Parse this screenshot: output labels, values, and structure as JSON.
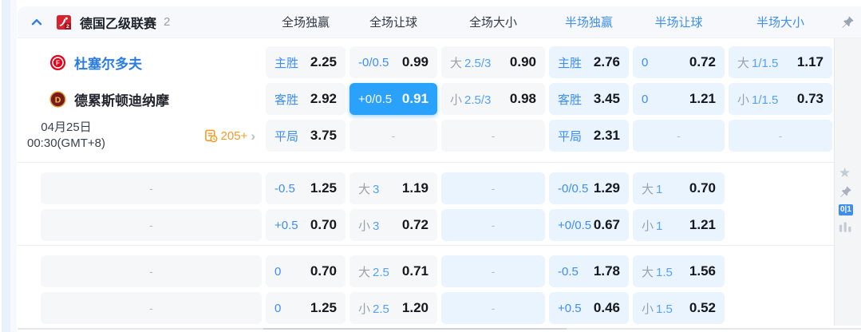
{
  "league_header": {
    "title": "德国乙级联赛",
    "match_count": "2",
    "full_columns": [
      "全场独赢",
      "全场让球",
      "全场大小"
    ],
    "half_columns": [
      "半场独赢",
      "半场让球",
      "半场大小"
    ]
  },
  "match_info": {
    "home_team": "杜塞尔多夫",
    "away_team": "德累斯顿迪纳摩",
    "date": "04月25日",
    "time": "00:30(GMT+8)",
    "markets_count": "205+"
  },
  "icons": {
    "more_chevron": "›",
    "star": "★",
    "compare_badge": "0|1"
  },
  "colors": {
    "accent_blue": "#3d8df5",
    "selected_cell": "#2aa1fb",
    "orange": "#f59b25"
  },
  "odds": {
    "block1": {
      "row1": {
        "ft_win": {
          "label": "主胜",
          "value": "2.25"
        },
        "ft_hcp": {
          "label": "-0/0.5",
          "value": "0.99"
        },
        "ft_ou": {
          "side": "大",
          "line": "2.5/3",
          "value": "0.90"
        },
        "ht_win": {
          "label": "主胜",
          "value": "2.76"
        },
        "ht_hcp": {
          "label": "0",
          "value": "0.72"
        },
        "ht_ou": {
          "side": "大",
          "line": "1/1.5",
          "value": "1.17"
        }
      },
      "row2": {
        "ft_win": {
          "label": "客胜",
          "value": "2.92"
        },
        "ft_hcp": {
          "label": "+0/0.5",
          "value": "0.91",
          "selected": true
        },
        "ft_ou": {
          "side": "小",
          "line": "2.5/3",
          "value": "0.98"
        },
        "ht_win": {
          "label": "客胜",
          "value": "3.45"
        },
        "ht_hcp": {
          "label": "0",
          "value": "1.21"
        },
        "ht_ou": {
          "side": "小",
          "line": "1/1.5",
          "value": "0.73"
        }
      },
      "row3": {
        "ft_win": {
          "label": "平局",
          "value": "3.75"
        },
        "ft_hcp": {
          "dash": "-"
        },
        "ft_ou": {
          "dash": "-"
        },
        "ht_win": {
          "label": "平局",
          "value": "2.31"
        },
        "ht_hcp": {
          "dash": "-"
        },
        "ht_ou": {
          "dash": "-"
        }
      }
    },
    "block2": {
      "row1": {
        "ft_win": {
          "dash": "-"
        },
        "ft_hcp": {
          "label": "-0.5",
          "value": "1.25"
        },
        "ft_ou": {
          "side": "大",
          "line": "3",
          "value": "1.19"
        },
        "ht_win": {
          "dash": "-"
        },
        "ht_hcp": {
          "label": "-0/0.5",
          "value": "1.29"
        },
        "ht_ou": {
          "side": "大",
          "line": "1",
          "value": "0.70"
        }
      },
      "row2": {
        "ft_win": {
          "dash": "-"
        },
        "ft_hcp": {
          "label": "+0.5",
          "value": "0.70"
        },
        "ft_ou": {
          "side": "小",
          "line": "3",
          "value": "0.72"
        },
        "ht_win": {
          "dash": "-"
        },
        "ht_hcp": {
          "label": "+0/0.5",
          "value": "0.67"
        },
        "ht_ou": {
          "side": "小",
          "line": "1",
          "value": "1.21"
        }
      }
    },
    "block3": {
      "row1": {
        "ft_win": {
          "dash": "-"
        },
        "ft_hcp": {
          "label": "0",
          "value": "0.70"
        },
        "ft_ou": {
          "side": "大",
          "line": "2.5",
          "value": "0.71"
        },
        "ht_win": {
          "dash": "-"
        },
        "ht_hcp": {
          "label": "-0.5",
          "value": "1.78"
        },
        "ht_ou": {
          "side": "大",
          "line": "1.5",
          "value": "1.56"
        }
      },
      "row2": {
        "ft_win": {
          "dash": "-"
        },
        "ft_hcp": {
          "label": "0",
          "value": "1.25"
        },
        "ft_ou": {
          "side": "小",
          "line": "2.5",
          "value": "1.20"
        },
        "ht_win": {
          "dash": "-"
        },
        "ht_hcp": {
          "label": "+0.5",
          "value": "0.46"
        },
        "ht_ou": {
          "side": "小",
          "line": "1.5",
          "value": "0.52"
        }
      }
    }
  }
}
